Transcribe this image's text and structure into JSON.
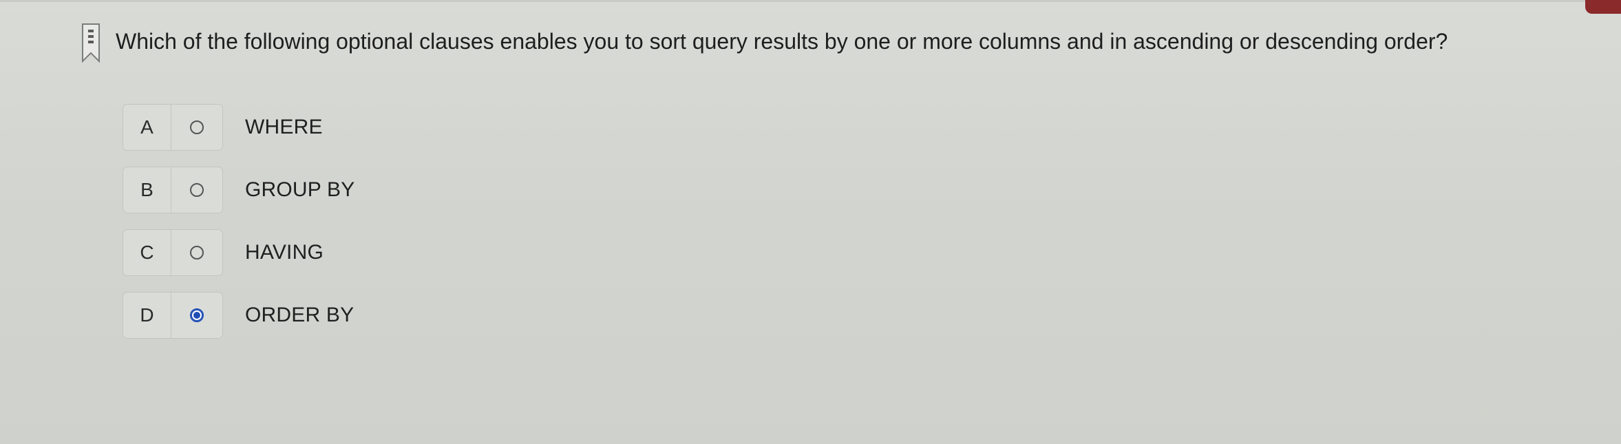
{
  "question": {
    "text": "Which of the following optional clauses enables you to sort query results by one or more columns and in ascending or descending order?"
  },
  "options": [
    {
      "letter": "A",
      "label": "WHERE",
      "selected": false
    },
    {
      "letter": "B",
      "label": "GROUP BY",
      "selected": false
    },
    {
      "letter": "C",
      "label": "HAVING",
      "selected": false
    },
    {
      "letter": "D",
      "label": "ORDER BY",
      "selected": true
    }
  ],
  "icons": {
    "flag": "bookmark-flag-icon"
  },
  "colors": {
    "selected_radio": "#1f4fb4",
    "corner_accent": "#8b2a2a"
  }
}
